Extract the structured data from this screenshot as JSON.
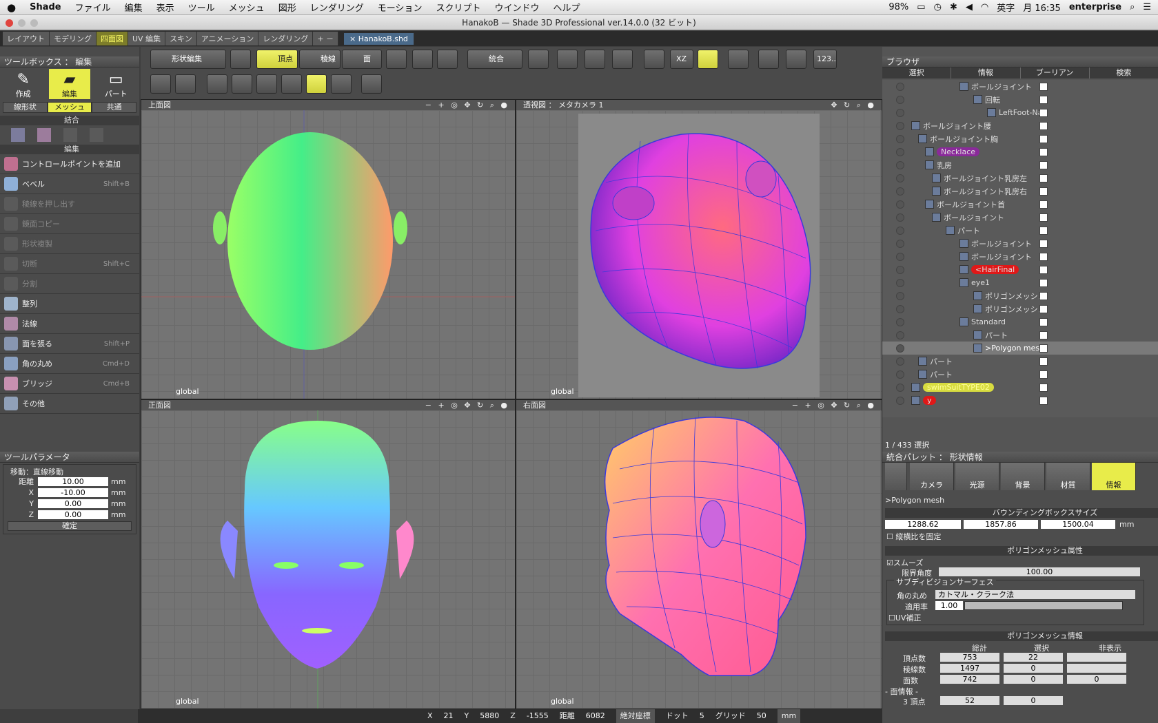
{
  "menubar": {
    "apple": "",
    "app": "Shade",
    "items": [
      "ファイル",
      "編集",
      "表示",
      "ツール",
      "メッシュ",
      "図形",
      "レンダリング",
      "モーション",
      "スクリプト",
      "ウインドウ",
      "ヘルプ"
    ],
    "battery": "98%",
    "input": "英字",
    "clock": "月 16:35",
    "user": "enterprise"
  },
  "window": {
    "title": "HanakoB — Shade 3D Professional ver.14.0.0 (32 ビット)"
  },
  "tabs": {
    "items": [
      "レイアウト",
      "モデリング",
      "四面図",
      "UV 編集",
      "スキン",
      "アニメーション",
      "レンダリング",
      "+ －"
    ],
    "active": "四面図",
    "document": "× HanakoB.shd"
  },
  "toolbox": {
    "title": "ツールボックス ： 編集",
    "modes": [
      "作成",
      "編集",
      "パート"
    ],
    "subtabs": [
      "線形状",
      "メッシュ",
      "共通"
    ],
    "section_merge": "結合",
    "section_edit": "編集",
    "tools": [
      {
        "label": "コントロールポイントを追加",
        "shortcut": ""
      },
      {
        "label": "ベベル",
        "shortcut": "Shift+B"
      },
      {
        "label": "稜線を押し出す",
        "shortcut": ""
      },
      {
        "label": "鏡面コピー",
        "shortcut": ""
      },
      {
        "label": "形状複製",
        "shortcut": ""
      },
      {
        "label": "切断",
        "shortcut": "Shift+C"
      },
      {
        "label": "分割",
        "shortcut": ""
      },
      {
        "label": "整列",
        "shortcut": ""
      },
      {
        "label": "法線",
        "shortcut": ""
      },
      {
        "label": "面を張る",
        "shortcut": "Shift+P"
      },
      {
        "label": "角の丸め",
        "shortcut": "Cmd+D"
      },
      {
        "label": "ブリッジ",
        "shortcut": "Cmd+B"
      },
      {
        "label": "その他",
        "shortcut": ""
      }
    ]
  },
  "toolparam": {
    "title": "ツールパラメータ",
    "mode": "移動：直線移動",
    "fields": [
      {
        "label": "距離",
        "value": "10.00",
        "unit": "mm"
      },
      {
        "label": "X",
        "value": "-10.00",
        "unit": "mm"
      },
      {
        "label": "Y",
        "value": "0.00",
        "unit": "mm"
      },
      {
        "label": "Z",
        "value": "0.00",
        "unit": "mm"
      }
    ],
    "confirm": "確定"
  },
  "toolbar": {
    "shape_edit": "形状編集",
    "vertex": "頂点",
    "edge": "稜線",
    "face": "面",
    "merge": "統合",
    "xz": "XZ",
    "num": "123.."
  },
  "viewports": [
    {
      "title": "上面図",
      "axis": "global"
    },
    {
      "title": "透視図 ： メタカメラ 1",
      "axis": "global"
    },
    {
      "title": "正面図",
      "axis": "global"
    },
    {
      "title": "右面図",
      "axis": "global"
    }
  ],
  "browser": {
    "title": "ブラウザ",
    "tabs": [
      "選択",
      "情報",
      "ブーリアン",
      "検索"
    ],
    "rows": [
      {
        "name": "ボールジョイント",
        "indent": 70,
        "tag": ""
      },
      {
        "name": "回転",
        "indent": 90,
        "tag": ""
      },
      {
        "name": "LeftFoot-Nail",
        "indent": 110,
        "tag": ""
      },
      {
        "name": "ボールジョイント腰",
        "indent": 0,
        "tag": ""
      },
      {
        "name": "ボールジョイント胸",
        "indent": 10,
        "tag": ""
      },
      {
        "name": "Necklace",
        "indent": 20,
        "tag": "purple"
      },
      {
        "name": "乳房",
        "indent": 20,
        "tag": ""
      },
      {
        "name": "ボールジョイント乳房左",
        "indent": 30,
        "tag": ""
      },
      {
        "name": "ボールジョイント乳房右",
        "indent": 30,
        "tag": ""
      },
      {
        "name": "ボールジョイント首",
        "indent": 20,
        "tag": ""
      },
      {
        "name": "ボールジョイント",
        "indent": 30,
        "tag": ""
      },
      {
        "name": "パート",
        "indent": 50,
        "tag": ""
      },
      {
        "name": "ボールジョイント",
        "indent": 70,
        "tag": ""
      },
      {
        "name": "ボールジョイント",
        "indent": 70,
        "tag": ""
      },
      {
        "name": "<HairFinal",
        "indent": 70,
        "tag": "red"
      },
      {
        "name": "eye1",
        "indent": 70,
        "tag": ""
      },
      {
        "name": "ポリゴンメッシュ",
        "indent": 90,
        "tag": ""
      },
      {
        "name": "ポリゴンメッシュ",
        "indent": 90,
        "tag": ""
      },
      {
        "name": "Standard",
        "indent": 70,
        "tag": ""
      },
      {
        "name": "パート",
        "indent": 90,
        "tag": ""
      },
      {
        "name": ">Polygon mesh",
        "indent": 90,
        "tag": "sel"
      },
      {
        "name": "パート",
        "indent": 10,
        "tag": ""
      },
      {
        "name": "パート",
        "indent": 10,
        "tag": ""
      },
      {
        "name": "swimSuitTYPE02",
        "indent": 0,
        "tag": "yellow"
      },
      {
        "name": "y",
        "indent": 0,
        "tag": "red"
      }
    ],
    "status": "1 / 433 選択"
  },
  "palette": {
    "title": "統合パレット ： 形状情報",
    "buttons": [
      "カメラ",
      "光源",
      "背景",
      "材質",
      "情報"
    ],
    "object": ">Polygon mesh",
    "bbox_title": "バウンディングボックスサイズ",
    "bbox": [
      "1288.62",
      "1857.86",
      "1500.04"
    ],
    "bbox_unit": "mm",
    "keep_ratio": "縦横比を固定",
    "attr_title": "ポリゴンメッシュ属性",
    "smooth": "スムーズ",
    "limit_angle_label": "限界角度",
    "limit_angle": "100.00",
    "subdiv_title": "サブディビジョンサーフェス",
    "round_label": "角の丸め",
    "round_method": "カトマル・クラーク法",
    "rate_label": "適用率",
    "rate": "1.00",
    "uv_fix": "UV補正",
    "info_title": "ポリゴンメッシュ情報",
    "cols": [
      "総計",
      "選択",
      "非表示"
    ],
    "rows": [
      {
        "label": "頂点数",
        "total": "753",
        "sel": "22",
        "hidden": ""
      },
      {
        "label": "稜線数",
        "total": "1497",
        "sel": "0",
        "hidden": ""
      },
      {
        "label": "面数",
        "total": "742",
        "sel": "0",
        "hidden": "0"
      }
    ],
    "face_info": "- 面情報 -",
    "tri_label": "3 頂点",
    "tri_total": "52",
    "tri_sel": "0"
  },
  "status": {
    "x_label": "X",
    "x": "21",
    "y_label": "Y",
    "y": "5880",
    "z_label": "Z",
    "z": "-1555",
    "dist_label": "距離",
    "dist": "6082",
    "coord": "絶対座標",
    "dot_label": "ドット",
    "dot": "5",
    "grid_label": "グリッド",
    "grid": "50",
    "unit": "mm"
  },
  "colors": {
    "accent": "#e8ec4a",
    "bg": "#4b4b4b",
    "wire": "#3a3adc"
  }
}
